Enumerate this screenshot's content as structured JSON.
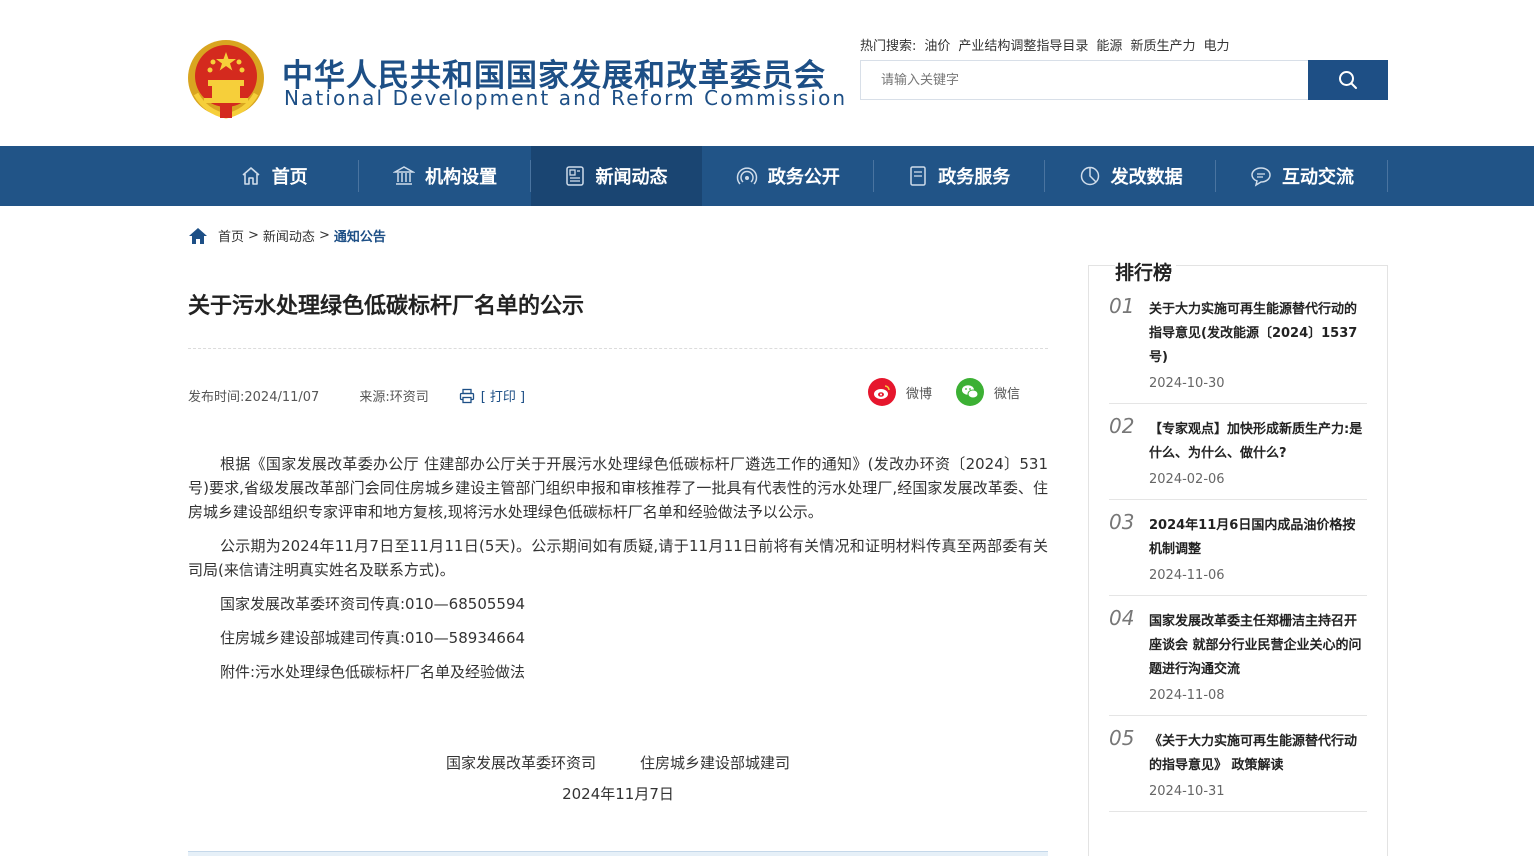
{
  "header": {
    "title_cn": "中华人民共和国国家发展和改革委员会",
    "title_en": "National Development and Reform Commission",
    "hot_search_label": "热门搜索:",
    "hot_search_items": [
      "油价",
      "产业结构调整指导目录",
      "能源",
      "新质生产力",
      "电力"
    ],
    "search_placeholder": "请输入关键字"
  },
  "nav": {
    "items": [
      {
        "label": "首页",
        "icon": "home-icon"
      },
      {
        "label": "机构设置",
        "icon": "building-icon"
      },
      {
        "label": "新闻动态",
        "icon": "news-icon"
      },
      {
        "label": "政务公开",
        "icon": "broadcast-icon"
      },
      {
        "label": "政务服务",
        "icon": "document-icon"
      },
      {
        "label": "发改数据",
        "icon": "pie-chart-icon"
      },
      {
        "label": "互动交流",
        "icon": "chat-icon"
      }
    ],
    "active_index": 2
  },
  "breadcrumb": {
    "home": "首页",
    "sep": ">",
    "level1": "新闻动态",
    "current": "通知公告"
  },
  "article": {
    "title": "关于污水处理绿色低碳标杆厂名单的公示",
    "publish_time": "发布时间:2024/11/07",
    "source": "来源:环资司",
    "print_label": "[ 打印 ]",
    "share_weibo": "微博",
    "share_wechat": "微信",
    "paragraphs": [
      "根据《国家发展改革委办公厅  住建部办公厅关于开展污水处理绿色低碳标杆厂遴选工作的通知》(发改办环资〔2024〕531号)要求,省级发展改革部门会同住房城乡建设主管部门组织申报和审核推荐了一批具有代表性的污水处理厂,经国家发展改革委、住房城乡建设部组织专家评审和地方复核,现将污水处理绿色低碳标杆厂名单和经验做法予以公示。",
      "公示期为2024年11月7日至11月11日(5天)。公示期间如有质疑,请于11月11日前将有关情况和证明材料传真至两部委有关司局(来信请注明真实姓名及联系方式)。",
      "国家发展改革委环资司传真:010—68505594",
      "住房城乡建设部城建司传真:010—58934664",
      "附件:污水处理绿色低碳标杆厂名单及经验做法"
    ],
    "signature_left": "国家发展改革委环资司",
    "signature_right": "住房城乡建设部城建司",
    "signature_date": "2024年11月7日"
  },
  "ranking": {
    "title": "排行榜",
    "items": [
      {
        "num": "01",
        "text": "关于大力实施可再生能源替代行动的指导意见(发改能源〔2024〕1537号)",
        "date": "2024-10-30"
      },
      {
        "num": "02",
        "text": "【专家观点】加快形成新质生产力:是什么、为什么、做什么?",
        "date": "2024-02-06"
      },
      {
        "num": "03",
        "text": "2024年11月6日国内成品油价格按机制调整",
        "date": "2024-11-06"
      },
      {
        "num": "04",
        "text": "国家发展改革委主任郑栅洁主持召开座谈会 就部分行业民营企业关心的问题进行沟通交流",
        "date": "2024-11-08"
      },
      {
        "num": "05",
        "text": "《关于大力实施可再生能源替代行动的指导意见》 政策解读",
        "date": "2024-10-31"
      }
    ]
  },
  "colors": {
    "brand_blue": "#215487",
    "nav_active": "#1a4572",
    "weibo_red": "#e6162d",
    "wechat_green": "#3cb034"
  }
}
